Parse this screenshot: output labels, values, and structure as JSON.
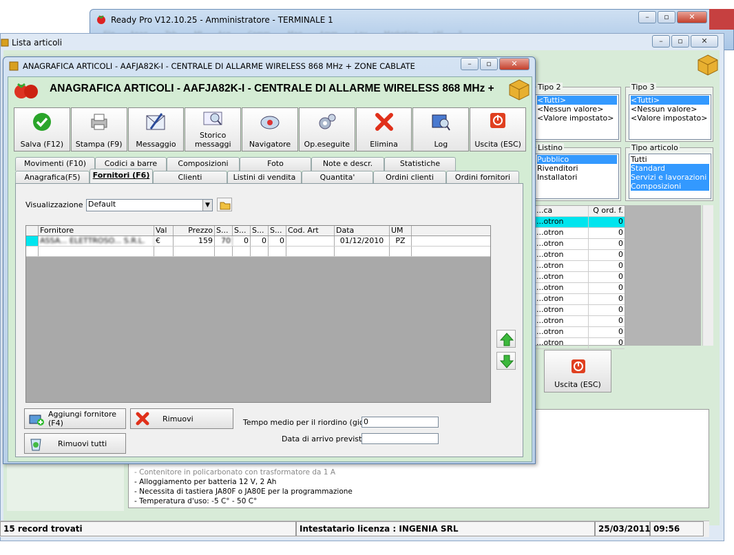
{
  "main_window": {
    "title": "Ready Pro V12.10.25 - Amministratore - TERMINALE 1",
    "menu": [
      "File",
      "Anag.",
      "Tab.",
      "Mt",
      "Acq.",
      "Comm.",
      "Mag.",
      "Amm.",
      "Lav.",
      "Marketing",
      "Utl",
      "?"
    ]
  },
  "lista": {
    "title": "Lista articoli"
  },
  "right": {
    "tipo2": {
      "caption": "Tipo 2",
      "items": [
        "<Tutti>",
        "<Nessun valore>",
        "<Valore impostato>"
      ],
      "selected": 0
    },
    "tipo3": {
      "caption": "Tipo 3",
      "items": [
        "<Tutti>",
        "<Nessun valore>",
        "<Valore impostato>"
      ],
      "selected": 0
    },
    "listino": {
      "caption": "Listino",
      "items": [
        "Pubblico",
        "Rivenditori",
        "Installatori"
      ],
      "selected": 0
    },
    "tipo_articolo": {
      "caption": "Tipo articolo",
      "items": [
        "Tutti",
        "Standard",
        "Servizi e lavorazioni",
        "Composizioni"
      ],
      "selected": [
        1,
        2,
        3
      ]
    },
    "qtable": {
      "headers": [
        "...ca",
        "Q ord. f."
      ],
      "rows": [
        [
          "...otron",
          "0"
        ],
        [
          "...otron",
          "0"
        ],
        [
          "...otron",
          "0"
        ],
        [
          "...otron",
          "0"
        ],
        [
          "...otron",
          "0"
        ],
        [
          "...otron",
          "0"
        ],
        [
          "...otron",
          "0"
        ],
        [
          "...otron",
          "0"
        ],
        [
          "...otron",
          "0"
        ],
        [
          "...otron",
          "0"
        ],
        [
          "...otron",
          "0"
        ],
        [
          "...otron",
          "0"
        ]
      ]
    },
    "uscita_label": "Uscita (ESC)"
  },
  "description": [
    "- Contenitore in policarbonato con trasformatore da 1 A",
    "- Alloggiamento per batteria 12 V, 2 Ah",
    "- Necessita di tastiera JA80F o JA80E per la programmazione",
    "- Temperatura d'uso: -5 C° - 50 C°"
  ],
  "status": {
    "records": "15 record trovati",
    "license": "Intestatario licenza : INGENIA SRL",
    "date": "25/03/2011",
    "time": "09:56"
  },
  "dialog": {
    "title": "ANAGRAFICA ARTICOLI - AAFJA82K-I - CENTRALE DI ALLARME WIRELESS 868 MHz + ZONE CABLATE",
    "heading": "ANAGRAFICA ARTICOLI - AAFJA82K-I - CENTRALE DI ALLARME WIRELESS 868 MHz +",
    "toolbar": [
      {
        "label": "Salva (F12)",
        "icon": "check-icon"
      },
      {
        "label": "Stampa (F9)",
        "icon": "printer-icon"
      },
      {
        "label": "Messaggio",
        "icon": "message-icon"
      },
      {
        "label": "Storico messaggi",
        "icon": "message-history-icon"
      },
      {
        "label": "Navigatore",
        "icon": "navigator-icon"
      },
      {
        "label": "Op.eseguite",
        "icon": "operations-icon"
      },
      {
        "label": "Elimina",
        "icon": "delete-icon"
      },
      {
        "label": "Log",
        "icon": "log-icon"
      },
      {
        "label": "Uscita (ESC)",
        "icon": "exit-icon"
      }
    ],
    "tabs_row1": [
      "Movimenti (F10)",
      "Codici a barre",
      "Composizioni",
      "Foto",
      "Note e descr.",
      "Statistiche"
    ],
    "tabs_row2": [
      "Anagrafica(F5)",
      "Fornitori (F6)",
      "Clienti",
      "Listini di vendita",
      "Quantita'",
      "Ordini clienti",
      "Ordini fornitori"
    ],
    "active_tab": "Fornitori (F6)",
    "visualizzazione_label": "Visualizzazione :",
    "visualizzazione_value": "Default",
    "grid": {
      "headers": [
        "Fornitore",
        "Val",
        "Prezzo",
        "S...",
        "S...",
        "S...",
        "S...",
        "Cod. Art",
        "Data",
        "UM"
      ],
      "rows": [
        [
          "ASSA... ELETTROSO... S.R.L.",
          "€",
          "159",
          "70",
          "0",
          "0",
          "0",
          "",
          "01/12/2010",
          "PZ"
        ]
      ]
    },
    "buttons": {
      "aggiungi": "Aggiungi fornitore (F4)",
      "rimuovi": "Rimuovi",
      "rimuovi_tutti": "Rimuovi tutti"
    },
    "tempo_label": "Tempo medio per il riordino (giorni) :",
    "tempo_value": "0",
    "data_arrivo_label": "Data di arrivo prevista :",
    "data_arrivo_value": ""
  },
  "colors": {
    "selection": "#3399ff",
    "cyan_row": "#00e5ee",
    "panel_green": "#d4ecd4"
  }
}
